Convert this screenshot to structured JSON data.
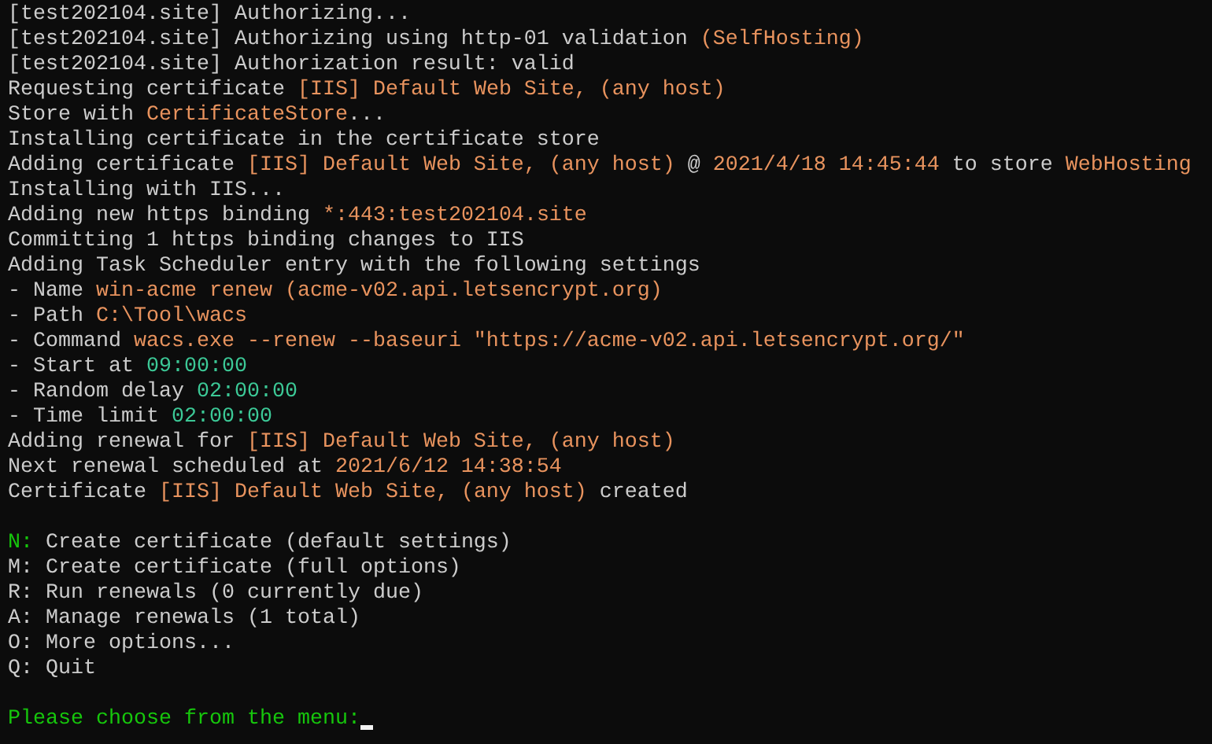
{
  "terminal": {
    "lines": [
      {
        "kind": "text",
        "segments": [
          {
            "text": "[test202104.site] Authorizing..."
          }
        ]
      },
      {
        "kind": "text",
        "segments": [
          {
            "text": "[test202104.site] Authorizing using http-01 validation "
          },
          {
            "text": "(SelfHosting)",
            "color": "#e8935e"
          }
        ]
      },
      {
        "kind": "text",
        "segments": [
          {
            "text": "[test202104.site] Authorization result: valid"
          }
        ]
      },
      {
        "kind": "text",
        "segments": [
          {
            "text": "Requesting certificate "
          },
          {
            "text": "[IIS] Default Web Site, (any host)",
            "color": "#e8935e"
          }
        ]
      },
      {
        "kind": "text",
        "segments": [
          {
            "text": "Store with "
          },
          {
            "text": "CertificateStore",
            "color": "#e8935e"
          },
          {
            "text": "..."
          }
        ]
      },
      {
        "kind": "text",
        "segments": [
          {
            "text": "Installing certificate in the certificate store"
          }
        ]
      },
      {
        "kind": "text",
        "segments": [
          {
            "text": "Adding certificate "
          },
          {
            "text": "[IIS] Default Web Site, (any host)",
            "color": "#e8935e"
          },
          {
            "text": " @ "
          },
          {
            "text": "2021/4/18 14:45:44",
            "color": "#e8935e"
          },
          {
            "text": " to store "
          },
          {
            "text": "WebHosting",
            "color": "#e8935e"
          }
        ]
      },
      {
        "kind": "text",
        "segments": [
          {
            "text": "Installing with IIS..."
          }
        ]
      },
      {
        "kind": "text",
        "segments": [
          {
            "text": "Adding new https binding "
          },
          {
            "text": "*:443:test202104.site",
            "color": "#e8935e"
          }
        ]
      },
      {
        "kind": "text",
        "segments": [
          {
            "text": "Committing 1 https binding changes to IIS"
          }
        ]
      },
      {
        "kind": "text",
        "segments": [
          {
            "text": "Adding Task Scheduler entry with the following settings"
          }
        ]
      },
      {
        "kind": "text",
        "segments": [
          {
            "text": "- Name "
          },
          {
            "text": "win-acme renew (acme-v02.api.letsencrypt.org)",
            "color": "#e8935e"
          }
        ]
      },
      {
        "kind": "text",
        "segments": [
          {
            "text": "- Path "
          },
          {
            "text": "C:\\Tool\\wacs",
            "color": "#e8935e"
          }
        ]
      },
      {
        "kind": "text",
        "segments": [
          {
            "text": "- Command "
          },
          {
            "text": "wacs.exe --renew --baseuri \"https://acme-v02.api.letsencrypt.org/\"",
            "color": "#e8935e"
          }
        ]
      },
      {
        "kind": "text",
        "segments": [
          {
            "text": "- Start at "
          },
          {
            "text": "09:00:00",
            "color": "#3cc896"
          }
        ]
      },
      {
        "kind": "text",
        "segments": [
          {
            "text": "- Random delay "
          },
          {
            "text": "02:00:00",
            "color": "#3cc896"
          }
        ]
      },
      {
        "kind": "text",
        "segments": [
          {
            "text": "- Time limit "
          },
          {
            "text": "02:00:00",
            "color": "#3cc896"
          }
        ]
      },
      {
        "kind": "text",
        "segments": [
          {
            "text": "Adding renewal for "
          },
          {
            "text": "[IIS] Default Web Site, (any host)",
            "color": "#e8935e"
          }
        ]
      },
      {
        "kind": "text",
        "segments": [
          {
            "text": "Next renewal scheduled at "
          },
          {
            "text": "2021/6/12 14:38:54",
            "color": "#e8935e"
          }
        ]
      },
      {
        "kind": "text",
        "segments": [
          {
            "text": "Certificate "
          },
          {
            "text": "[IIS] Default Web Site, (any host)",
            "color": "#e8935e"
          },
          {
            "text": " created"
          }
        ]
      },
      {
        "kind": "blank"
      },
      {
        "kind": "text",
        "segments": [
          {
            "text": "N:",
            "color": "#16c60c"
          },
          {
            "text": " Create certificate (default settings)"
          }
        ]
      },
      {
        "kind": "text",
        "segments": [
          {
            "text": "M: Create certificate (full options)"
          }
        ]
      },
      {
        "kind": "text",
        "segments": [
          {
            "text": "R: Run renewals (0 currently due)"
          }
        ]
      },
      {
        "kind": "text",
        "segments": [
          {
            "text": "A: Manage renewals (1 total)"
          }
        ]
      },
      {
        "kind": "text",
        "segments": [
          {
            "text": "O: More options..."
          }
        ]
      },
      {
        "kind": "text",
        "segments": [
          {
            "text": "Q: Quit"
          }
        ]
      },
      {
        "kind": "blank"
      },
      {
        "kind": "prompt",
        "segments": [
          {
            "text": "Please choose from the menu:",
            "color": "#16c60c"
          }
        ]
      }
    ]
  }
}
